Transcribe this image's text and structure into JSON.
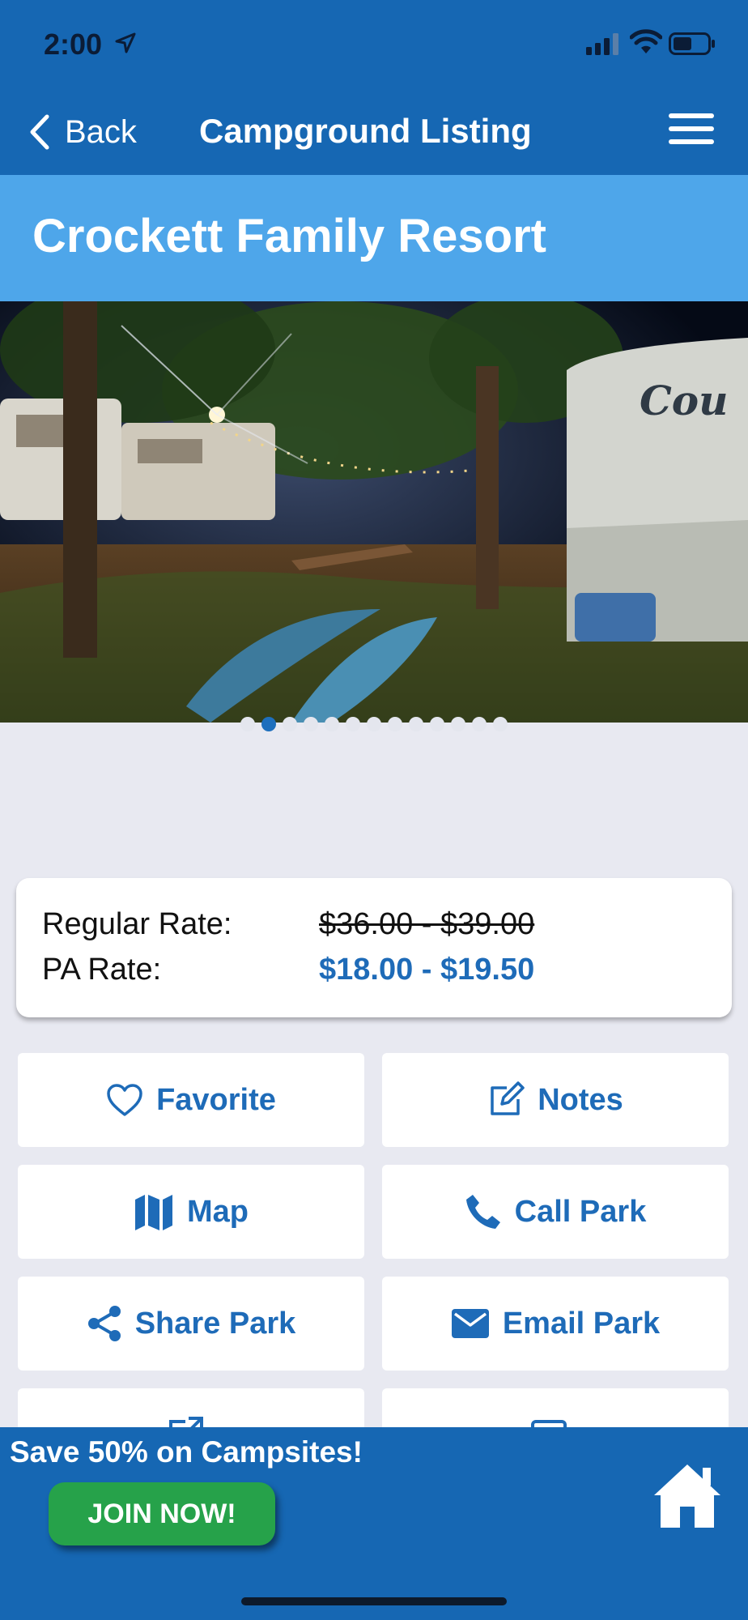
{
  "status_bar": {
    "time": "2:00"
  },
  "nav": {
    "back_label": "Back",
    "title": "Campground Listing"
  },
  "park": {
    "name": "Crockett Family Resort",
    "photo_sign_text": "Cou"
  },
  "carousel": {
    "total_images": 13,
    "current_index": 1
  },
  "rates": {
    "regular_label": "Regular Rate:",
    "regular_value": "$36.00 - $39.00",
    "pa_label": "PA Rate:",
    "pa_value": "$18.00 - $19.50"
  },
  "actions": [
    {
      "label": "Favorite",
      "icon": "heart-icon"
    },
    {
      "label": "Notes",
      "icon": "notes-icon"
    },
    {
      "label": "Map",
      "icon": "map-icon"
    },
    {
      "label": "Call Park",
      "icon": "phone-icon"
    },
    {
      "label": "Share Park",
      "icon": "share-icon"
    },
    {
      "label": "Email Park",
      "icon": "envelope-icon"
    }
  ],
  "promo": {
    "text": "Save 50% on Campsites!",
    "join_label": "JOIN NOW!"
  },
  "colors": {
    "nav_blue": "#1667b3",
    "header_blue": "#4ea6ea",
    "accent_blue": "#1e6bb8",
    "join_green": "#26a24a",
    "background": "#e8e9f1"
  }
}
